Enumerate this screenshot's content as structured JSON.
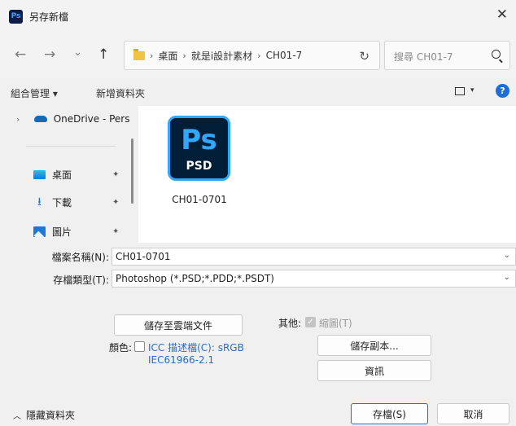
{
  "titlebar": {
    "app_icon": "Ps",
    "title": "另存新檔",
    "close": "✕"
  },
  "nav": {
    "back": "←",
    "forward": "→",
    "recent": "⌄",
    "up": "↑"
  },
  "address": {
    "crumbs": [
      "桌面",
      "就是i設計素材",
      "CH01-7"
    ],
    "sep": "›",
    "refresh": "↻"
  },
  "search": {
    "placeholder": "搜尋 CH01-7"
  },
  "cmdbar": {
    "organize": "組合管理 ▾",
    "new_folder": "新增資料夾",
    "help": "?"
  },
  "sidebar": {
    "items": [
      {
        "label": "OneDrive - Pers",
        "icon": "cloud-icon"
      },
      {
        "label": "桌面",
        "icon": "desktop-icon",
        "pin": "📌"
      },
      {
        "label": "下載",
        "icon": "download-icon",
        "pin": "📌"
      },
      {
        "label": "圖片",
        "icon": "pictures-icon",
        "pin": "📌"
      }
    ]
  },
  "file": {
    "icon_text": "Ps",
    "icon_subtext": "PSD",
    "name": "CH01-0701"
  },
  "fields": {
    "filename_label": "檔案名稱(N):",
    "filename_value": "CH01-0701",
    "filetype_label": "存檔類型(T):",
    "filetype_value": "Photoshop (*.PSD;*.PDD;*.PSDT)"
  },
  "options": {
    "save_cloud": "儲存至雲端文件",
    "other_label": "其他:",
    "thumbnail_label": "縮圖(T)",
    "color_label": "顏色:",
    "icc_line1": "ICC 描述檔(C):  sRGB",
    "icc_line2": "IEC61966-2.1",
    "save_copy": "儲存副本...",
    "info": "資訊"
  },
  "footer": {
    "hide_folders": "隱藏資料夾",
    "save": "存檔(S)",
    "cancel": "取消"
  }
}
